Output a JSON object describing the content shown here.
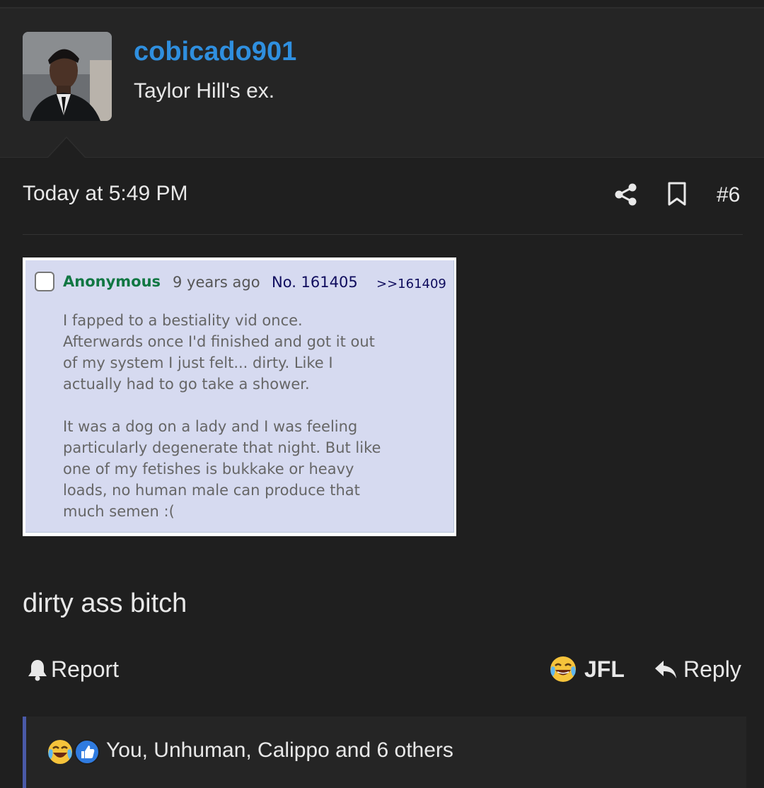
{
  "post": {
    "username": "cobicado901",
    "user_title": "Taylor Hill's ex.",
    "timestamp": "Today at 5:49 PM",
    "post_number": "#6",
    "body_text": "dirty ass bitch"
  },
  "greentext": {
    "name": "Anonymous",
    "date": "9 years ago",
    "post_no": "No. 161405",
    "reply_ref": ">>161409",
    "paragraph1": "I fapped to a bestiality vid once.\nAfterwards once I'd finished and got it out\nof my system I just felt... dirty. Like I\nactually had to go take a shower.",
    "paragraph2": "It was a dog on a lady and I was feeling\nparticularly degenerate that night. But like\none of my fetishes is bukkake or heavy\nloads, no human male can produce that\nmuch semen :("
  },
  "actions": {
    "report_label": "Report",
    "reaction_label": "JFL",
    "reply_label": "Reply"
  },
  "reactions": {
    "summary": "You, Unhuman, Calippo and 6 others",
    "icons": [
      "crying-laughing-emoji",
      "thumbs-up-emoji"
    ]
  },
  "colors": {
    "username": "#2f8fdf",
    "background": "#1f1f1f",
    "greentext_bg": "#d6daf0",
    "anon_name": "#117743",
    "reaction_accent": "#4a5aa8"
  }
}
